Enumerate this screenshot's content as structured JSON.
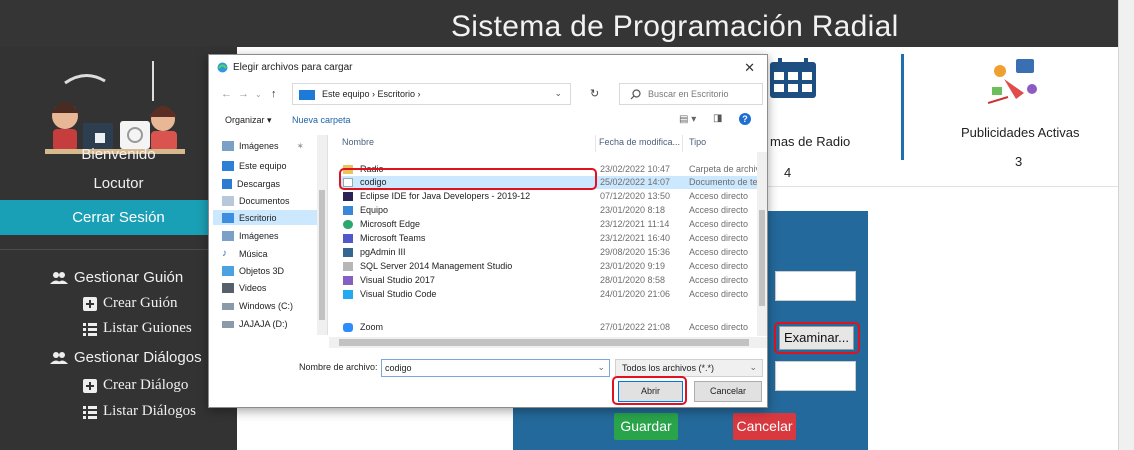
{
  "app": {
    "title": "Sistema de Programación Radial"
  },
  "sidebar": {
    "welcome": "Bienvenido",
    "role": "Locutor",
    "logout": "Cerrar Sesión",
    "menu": [
      {
        "label": "Gestionar Guión",
        "icon": "users-icon",
        "level": "group"
      },
      {
        "label": "Crear Guión",
        "icon": "plus-square-icon",
        "level": "sub"
      },
      {
        "label": "Listar Guiones",
        "icon": "list-icon",
        "level": "sub"
      },
      {
        "label": "Gestionar Diálogos",
        "icon": "users-icon",
        "level": "group"
      },
      {
        "label": "Crear Diálogo",
        "icon": "plus-square-icon",
        "level": "sub"
      },
      {
        "label": "Listar Diálogos",
        "icon": "list-icon",
        "level": "sub"
      }
    ]
  },
  "cards": [
    {
      "label": "mas de Radio",
      "value": "4",
      "icon": "calendar-icon"
    },
    {
      "label": "Publicidades Activas",
      "value": "3",
      "icon": "advertising-icon"
    }
  ],
  "form": {
    "browse_label": "Examinar...",
    "save_label": "Guardar",
    "cancel_label": "Cancelar"
  },
  "dialog": {
    "title": "Elegir archivos para cargar",
    "breadcrumb": "Este equipo  ›  Escritorio  ›",
    "search_placeholder": "Buscar en Escritorio",
    "organize": "Organizar ▾",
    "new_folder": "Nueva carpeta",
    "nav_items": [
      {
        "label": "Imágenes",
        "icon": "images-folder-icon"
      },
      {
        "label": "Este equipo",
        "icon": "computer-icon"
      },
      {
        "label": "Descargas",
        "icon": "downloads-icon"
      },
      {
        "label": "Documentos",
        "icon": "documents-icon"
      },
      {
        "label": "Escritorio",
        "icon": "desktop-icon",
        "selected": true
      },
      {
        "label": "Imágenes",
        "icon": "images-folder-icon"
      },
      {
        "label": "Música",
        "icon": "music-icon"
      },
      {
        "label": "Objetos 3D",
        "icon": "objects-3d-icon"
      },
      {
        "label": "Videos",
        "icon": "videos-icon"
      },
      {
        "label": "Windows (C:)",
        "icon": "drive-icon"
      },
      {
        "label": "JAJAJA (D:)",
        "icon": "drive-icon"
      }
    ],
    "columns": {
      "name": "Nombre",
      "date": "Fecha de modifica...",
      "type": "Tipo"
    },
    "files": [
      {
        "name": "Radio",
        "date": "23/02/2022 10:47",
        "type": "Carpeta de archiv",
        "icon": "folder-icon"
      },
      {
        "name": "codigo",
        "date": "25/02/2022 14:07",
        "type": "Documento de te",
        "icon": "text-file-icon",
        "selected": true
      },
      {
        "name": "Eclipse IDE for Java Developers - 2019-12",
        "date": "07/12/2020 13:50",
        "type": "Acceso directo",
        "icon": "eclipse-icon"
      },
      {
        "name": "Equipo",
        "date": "23/01/2020 8:18",
        "type": "Acceso directo",
        "icon": "computer-icon"
      },
      {
        "name": "Microsoft Edge",
        "date": "23/12/2021 11:14",
        "type": "Acceso directo",
        "icon": "edge-icon"
      },
      {
        "name": "Microsoft Teams",
        "date": "23/12/2021 16:40",
        "type": "Acceso directo",
        "icon": "teams-icon"
      },
      {
        "name": "pgAdmin III",
        "date": "29/08/2020 15:36",
        "type": "Acceso directo",
        "icon": "pgadmin-icon"
      },
      {
        "name": "SQL Server 2014 Management Studio",
        "date": "23/01/2020 9:19",
        "type": "Acceso directo",
        "icon": "sql-server-icon"
      },
      {
        "name": "Visual Studio 2017",
        "date": "28/01/2020 8:58",
        "type": "Acceso directo",
        "icon": "visual-studio-icon"
      },
      {
        "name": "Visual Studio Code",
        "date": "24/01/2020 21:06",
        "type": "Acceso directo",
        "icon": "vscode-icon"
      },
      {
        "name": "Zoom",
        "date": "27/01/2022 21:08",
        "type": "Acceso directo",
        "icon": "zoom-icon"
      }
    ],
    "filename_label": "Nombre de archivo:",
    "filename_value": "codigo",
    "filter_value": "Todos los archivos (*.*)",
    "open_label": "Abrir",
    "cancel_label": "Cancelar"
  },
  "colors": {
    "topbar": "#353535",
    "sidebar": "#333333",
    "logout": "#1aa0b6",
    "form_panel": "#24699b",
    "save": "#2aa44b",
    "cancel": "#d8393f",
    "highlight": "#e0121f",
    "selection": "#cce8ff"
  }
}
